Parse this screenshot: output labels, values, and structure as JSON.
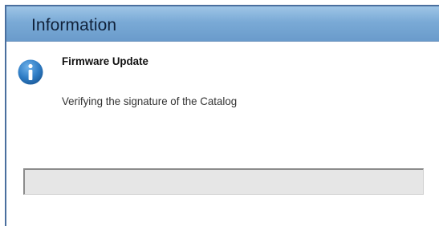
{
  "dialog": {
    "title": "Information",
    "icon": "info-icon",
    "heading": "Firmware Update",
    "message": "Verifying the signature of the Catalog",
    "progress": 0
  },
  "colors": {
    "titlebar": "#7aaad6",
    "icon": "#2f7cc4",
    "progress_track": "#e6e6e6"
  }
}
